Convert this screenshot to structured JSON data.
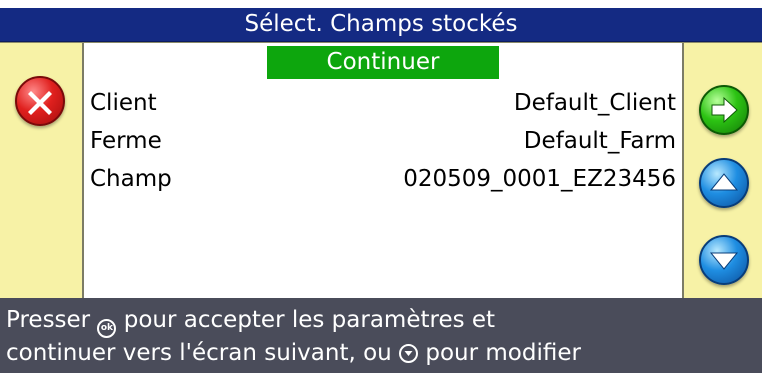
{
  "dialog": {
    "title": "Sélect. Champs stockés",
    "continue_label": "Continuer"
  },
  "fields": [
    {
      "label": "Client",
      "value": "Default_Client"
    },
    {
      "label": "Ferme",
      "value": "Default_Farm"
    },
    {
      "label": "Champ",
      "value": "020509_0001_EZ23456"
    }
  ],
  "footer": {
    "part1": "Presser ",
    "ok_glyph": "ok",
    "part2": " pour accepter les paramètres et",
    "part3": "continuer vers l'écran suivant, ou ",
    "part4": " pour modifier"
  },
  "icons": {
    "cancel": "close-icon",
    "next": "arrow-right-icon",
    "up": "arrow-up-icon",
    "down": "arrow-down-icon"
  },
  "colors": {
    "title_bar": "#142a83",
    "panel": "#f7f2a6",
    "continue": "#0da60d",
    "footer": "#4a4c5a"
  }
}
